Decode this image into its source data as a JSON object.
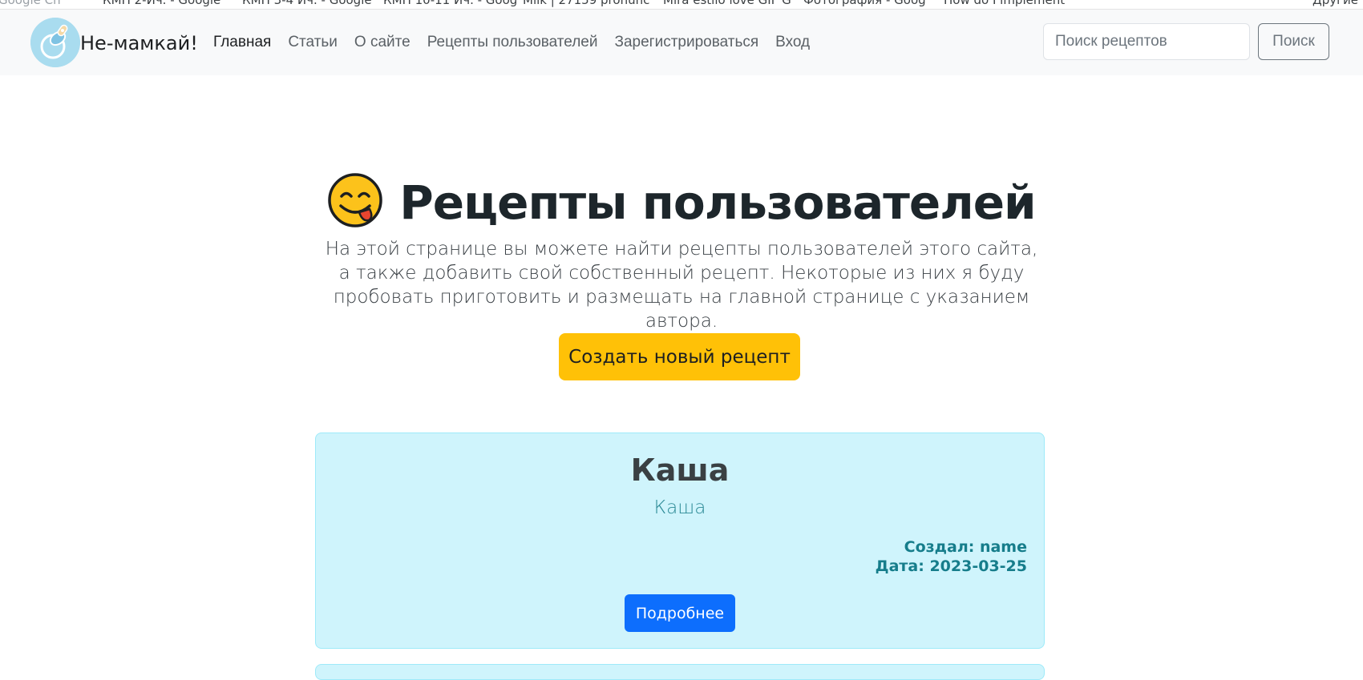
{
  "bookmarks": [
    {
      "label": "Google Ch",
      "fade": true
    },
    {
      "label": "КМП 2-Ич. - Google",
      "fade": false
    },
    {
      "label": "КМП 3-4 Ич. - Google",
      "fade": false
    },
    {
      "label": "КМП 10-11 Ич. - Goog",
      "fade": false
    },
    {
      "label": "Milk | 27159 pronunc",
      "fade": false
    },
    {
      "label": "Mira estilo love GIF G",
      "fade": false
    },
    {
      "label": "Фотография - Goog",
      "fade": false
    },
    {
      "label": "How do I implement",
      "fade": false
    },
    {
      "label": "Другие",
      "fade": false
    }
  ],
  "navbar": {
    "brand": "Не-мамкай!",
    "links": [
      "Главная",
      "Статьи",
      "О сайте",
      "Рецепты пользователей",
      "Зарегистрироваться",
      "Вход"
    ],
    "active_index": 0,
    "search_placeholder": "Поиск рецептов",
    "search_button": "Поиск"
  },
  "hero": {
    "emoji": "face-savoring-food-icon",
    "title": "Рецепты пользователей",
    "lead": "На этой странице вы можете найти рецепты пользователей этого сайта, а также добавить свой собственный рецепт. Некоторые из них я буду пробовать приготовить и размещать на главной странице с указанием автора.",
    "create_button": "Создать новый рецепт"
  },
  "recipes": [
    {
      "title": "Каша",
      "subtitle": "Каша",
      "author": "Создал: name",
      "date": "Дата: 2023-03-25",
      "button": "Подробнее"
    }
  ],
  "colors": {
    "navbar_bg": "#f8f9fa",
    "warning": "#ffc107",
    "primary": "#0d6efd",
    "info_bg": "#cff4fc",
    "info_border": "#9eeaf9",
    "info_text": "#167d8b"
  }
}
